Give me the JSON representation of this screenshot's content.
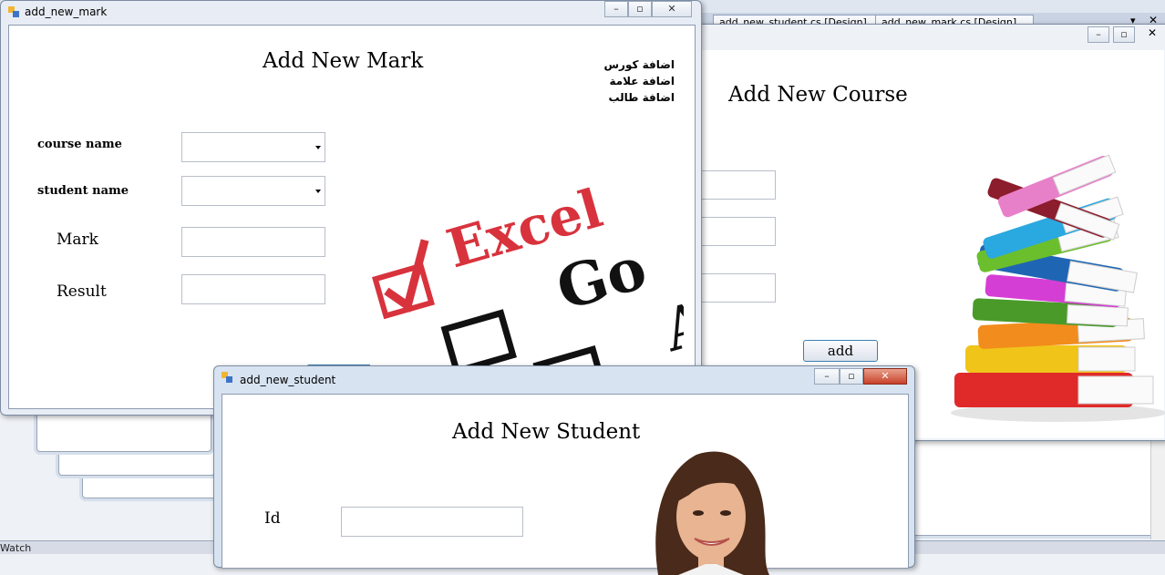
{
  "ide": {
    "tabs": [
      "add_new_student.cs [Design]",
      "add_new_mark.cs [Design]"
    ],
    "status_label": "Watch"
  },
  "mark_window": {
    "title": "add_new_mark",
    "form_title": "Add New Mark",
    "menu": [
      "اضافة كورس",
      "اضافة علامة",
      "اضافة طالب"
    ],
    "labels": {
      "course": "course name",
      "student": "student name",
      "mark": "Mark",
      "result": "Result"
    },
    "image_words": [
      "Excel",
      "Go",
      "A"
    ]
  },
  "course_window": {
    "form_title": "Add New Course",
    "add_label": "add"
  },
  "student_window": {
    "title": "add_new_student",
    "form_title": "Add New Student",
    "id_label": "Id"
  },
  "colors": {
    "check_red": "#d8333d",
    "button_border": "#3c7fb1"
  }
}
